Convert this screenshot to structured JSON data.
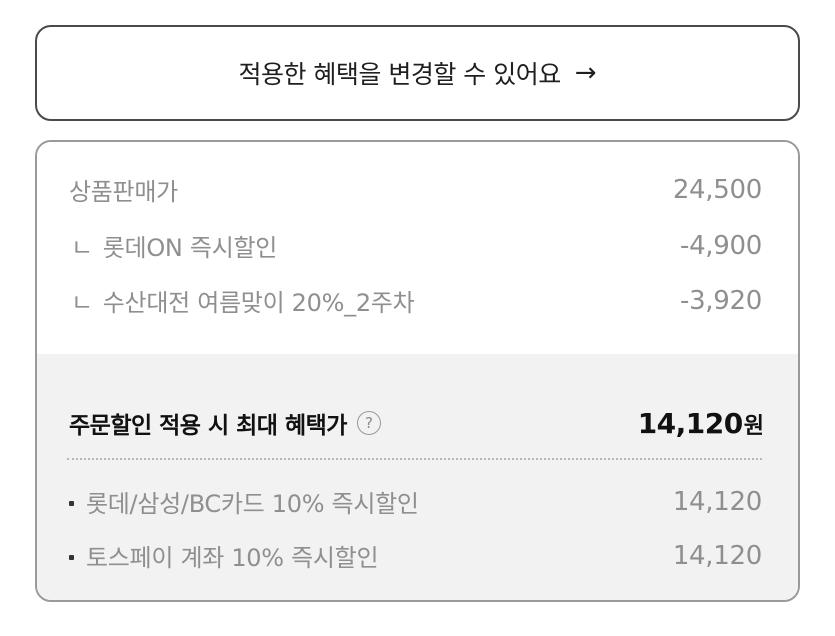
{
  "change_benefit": {
    "label": "적용한 혜택을 변경할 수 있어요",
    "arrow": "→"
  },
  "price_breakdown": {
    "base": {
      "label": "상품판매가",
      "value": "24,500"
    },
    "discounts": [
      {
        "prefix": "ㄴ",
        "label": "롯데ON 즉시할인",
        "value": "-4,900"
      },
      {
        "prefix": "ㄴ",
        "label": "수산대전 여름맞이 20%_2주차",
        "value": "-3,920"
      }
    ]
  },
  "max_benefit": {
    "label": "주문할인 적용 시 최대 혜택가",
    "help_icon": "question-circle-icon",
    "help_glyph": "?",
    "amount": "14,120",
    "currency": "원"
  },
  "card_discounts": [
    {
      "label": "롯데/삼성/BC카드 10% 즉시할인",
      "value": "14,120"
    },
    {
      "label": "토스페이 계좌 10% 즉시할인",
      "value": "14,120"
    }
  ],
  "colors": {
    "button_border": "#4a4a4a",
    "card_border": "#9a9a9a",
    "muted_text": "#8f8f8f",
    "emphasis_text": "#111111",
    "section_bg": "#f2f2f2"
  }
}
